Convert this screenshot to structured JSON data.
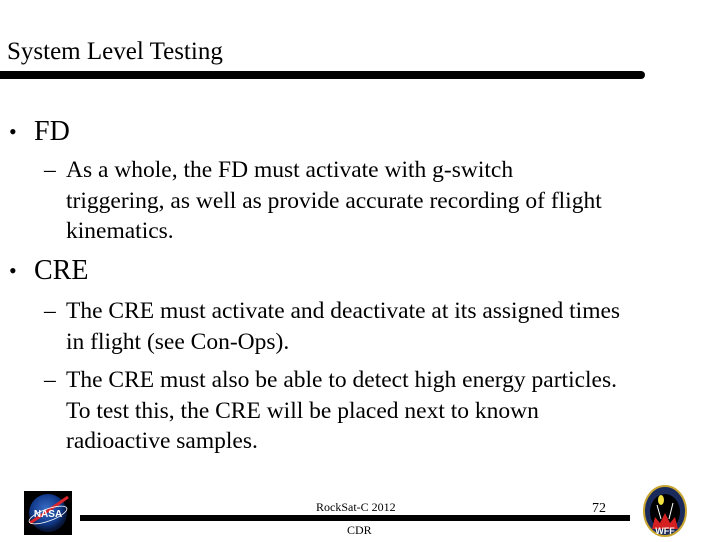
{
  "slide": {
    "title": "System Level Testing",
    "bullets": [
      {
        "label": "FD",
        "subitems": [
          "As a whole, the FD must activate with g-switch triggering, as well as provide accurate recording of flight kinematics."
        ]
      },
      {
        "label": "CRE",
        "subitems": [
          "The CRE must activate and deactivate at its assigned times in flight (see Con-Ops).",
          "The CRE must also be able to detect high energy particles. To test this, the CRE will be placed next to known radioactive samples."
        ]
      }
    ],
    "bullet_glyph": "•",
    "dash_glyph": "–"
  },
  "footer": {
    "event": "RockSat-C 2012",
    "review": "CDR",
    "page_number": "72",
    "left_logo": "NASA",
    "right_logo": "WFF"
  }
}
